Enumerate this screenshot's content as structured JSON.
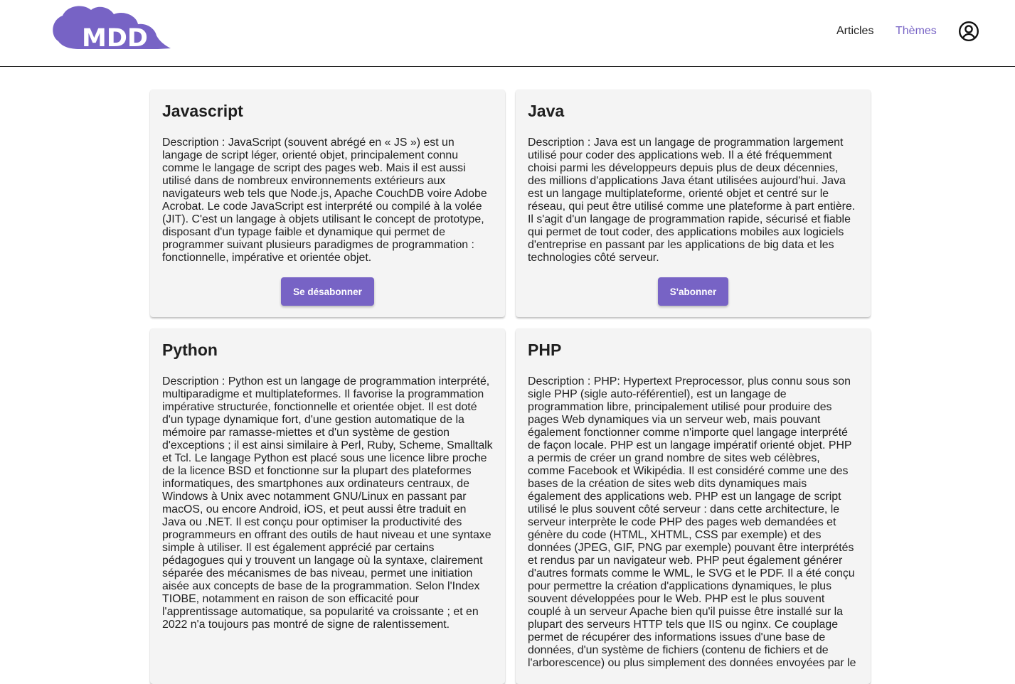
{
  "header": {
    "logo_text": "MDD",
    "nav": {
      "articles": "Articles",
      "themes": "Thèmes"
    },
    "icons": {
      "profile": "account-circle-icon"
    }
  },
  "colors": {
    "accent": "#7763c5",
    "card_background": "#f4f4f4",
    "text": "#1f1f1f"
  },
  "themes": [
    {
      "title": "Javascript",
      "description": "Description : JavaScript (souvent abrégé en « JS ») est un langage de script léger, orienté objet, principalement connu comme le langage de script des pages web. Mais il est aussi utilisé dans de nombreux environnements extérieurs aux navigateurs web tels que Node.js, Apache CouchDB voire Adobe Acrobat. Le code JavaScript est interprété ou compilé à la volée (JIT). C'est un langage à objets utilisant le concept de prototype, disposant d'un typage faible et dynamique qui permet de programmer suivant plusieurs paradigmes de programmation : fonctionnelle, impérative et orientée objet.",
      "button": "Se désabonner"
    },
    {
      "title": "Java",
      "description": "Description : Java est un langage de programmation largement utilisé pour coder des applications web. Il a été fréquemment choisi parmi les développeurs depuis plus de deux décennies, des millions d'applications Java étant utilisées aujourd'hui. Java est un langage multiplateforme, orienté objet et centré sur le réseau, qui peut être utilisé comme une plateforme à part entière. Il s'agit d'un langage de programmation rapide, sécurisé et fiable qui permet de tout coder, des applications mobiles aux logiciels d'entreprise en passant par les applications de big data et les technologies côté serveur.",
      "button": "S'abonner"
    },
    {
      "title": "Python",
      "description": "Description : Python est un langage de programmation interprété, multiparadigme et multiplateformes. Il favorise la programmation impérative structurée, fonctionnelle et orientée objet. Il est doté d'un typage dynamique fort, d'une gestion automatique de la mémoire par ramasse-miettes et d'un système de gestion d'exceptions ; il est ainsi similaire à Perl, Ruby, Scheme, Smalltalk et Tcl. Le langage Python est placé sous une licence libre proche de la licence BSD et fonctionne sur la plupart des plateformes informatiques, des smartphones aux ordinateurs centraux, de Windows à Unix avec notamment GNU/Linux en passant par macOS, ou encore Android, iOS, et peut aussi être traduit en Java ou .NET. Il est conçu pour optimiser la productivité des programmeurs en offrant des outils de haut niveau et une syntaxe simple à utiliser. Il est également apprécié par certains pédagogues qui y trouvent un langage où la syntaxe, clairement séparée des mécanismes de bas niveau, permet une initiation aisée aux concepts de base de la programmation. Selon l'Index TIOBE, notamment en raison de son efficacité pour l'apprentissage automatique, sa popularité va croissante ; et en 2022 n'a toujours pas montré de signe de ralentissement."
    },
    {
      "title": "PHP",
      "description": "Description : PHP: Hypertext Preprocessor, plus connu sous son sigle PHP (sigle auto-référentiel), est un langage de programmation libre, principalement utilisé pour produire des pages Web dynamiques via un serveur web, mais pouvant également fonctionner comme n'importe quel langage interprété de façon locale. PHP est un langage impératif orienté objet. PHP a permis de créer un grand nombre de sites web célèbres, comme Facebook et Wikipédia. Il est considéré comme une des bases de la création de sites web dits dynamiques mais également des applications web. PHP est un langage de script utilisé le plus souvent côté serveur : dans cette architecture, le serveur interprète le code PHP des pages web demandées et génère du code (HTML, XHTML, CSS par exemple) et des données (JPEG, GIF, PNG par exemple) pouvant être interprétés et rendus par un navigateur web. PHP peut également générer d'autres formats comme le WML, le SVG et le PDF. Il a été conçu pour permettre la création d'applications dynamiques, le plus souvent développées pour le Web. PHP est le plus souvent couplé à un serveur Apache bien qu'il puisse être installé sur la plupart des serveurs HTTP tels que IIS ou nginx. Ce couplage permet de récupérer des informations issues d'une base de données, d'un système de fichiers (contenu de fichiers et de l'arborescence) ou plus simplement des données envoyées par le"
    }
  ]
}
